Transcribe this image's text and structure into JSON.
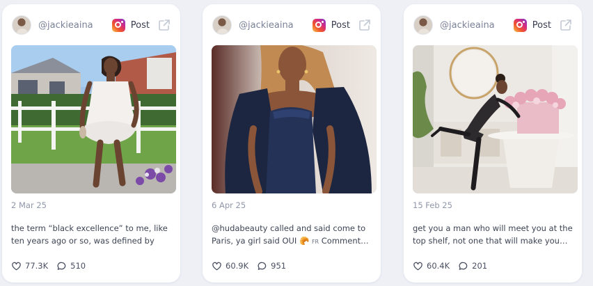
{
  "cards": [
    {
      "handle": "@jackieaina",
      "platform_label": "Post",
      "date": "2 Mar 25",
      "caption": "the term “black excellence” to me, like ten years ago or so, was defined by ho…",
      "likes": "77.3K",
      "comments": "510"
    },
    {
      "handle": "@jackieaina",
      "platform_label": "Post",
      "date": "6 Apr 25",
      "caption_main": "@hudabeauty called and said come to Paris, ya girl said OUI 🥐",
      "caption_flag": "FR",
      "caption_tail": " Comment…",
      "likes": "60.9K",
      "comments": "951"
    },
    {
      "handle": "@jackieaina",
      "platform_label": "Post",
      "date": "15 Feb 25",
      "caption": "get you a man who will meet you at the top shelf, not one that will make you…",
      "likes": "60.4K",
      "comments": "201"
    }
  ],
  "icons": {
    "platform": "instagram-icon",
    "external": "external-link-icon",
    "like": "heart-icon",
    "comment": "comment-bubble-icon"
  },
  "colors": {
    "page_bg": "#eef0f6",
    "card_bg": "#ffffff",
    "muted_text": "#8f96a9",
    "body_text": "#3e4455"
  }
}
